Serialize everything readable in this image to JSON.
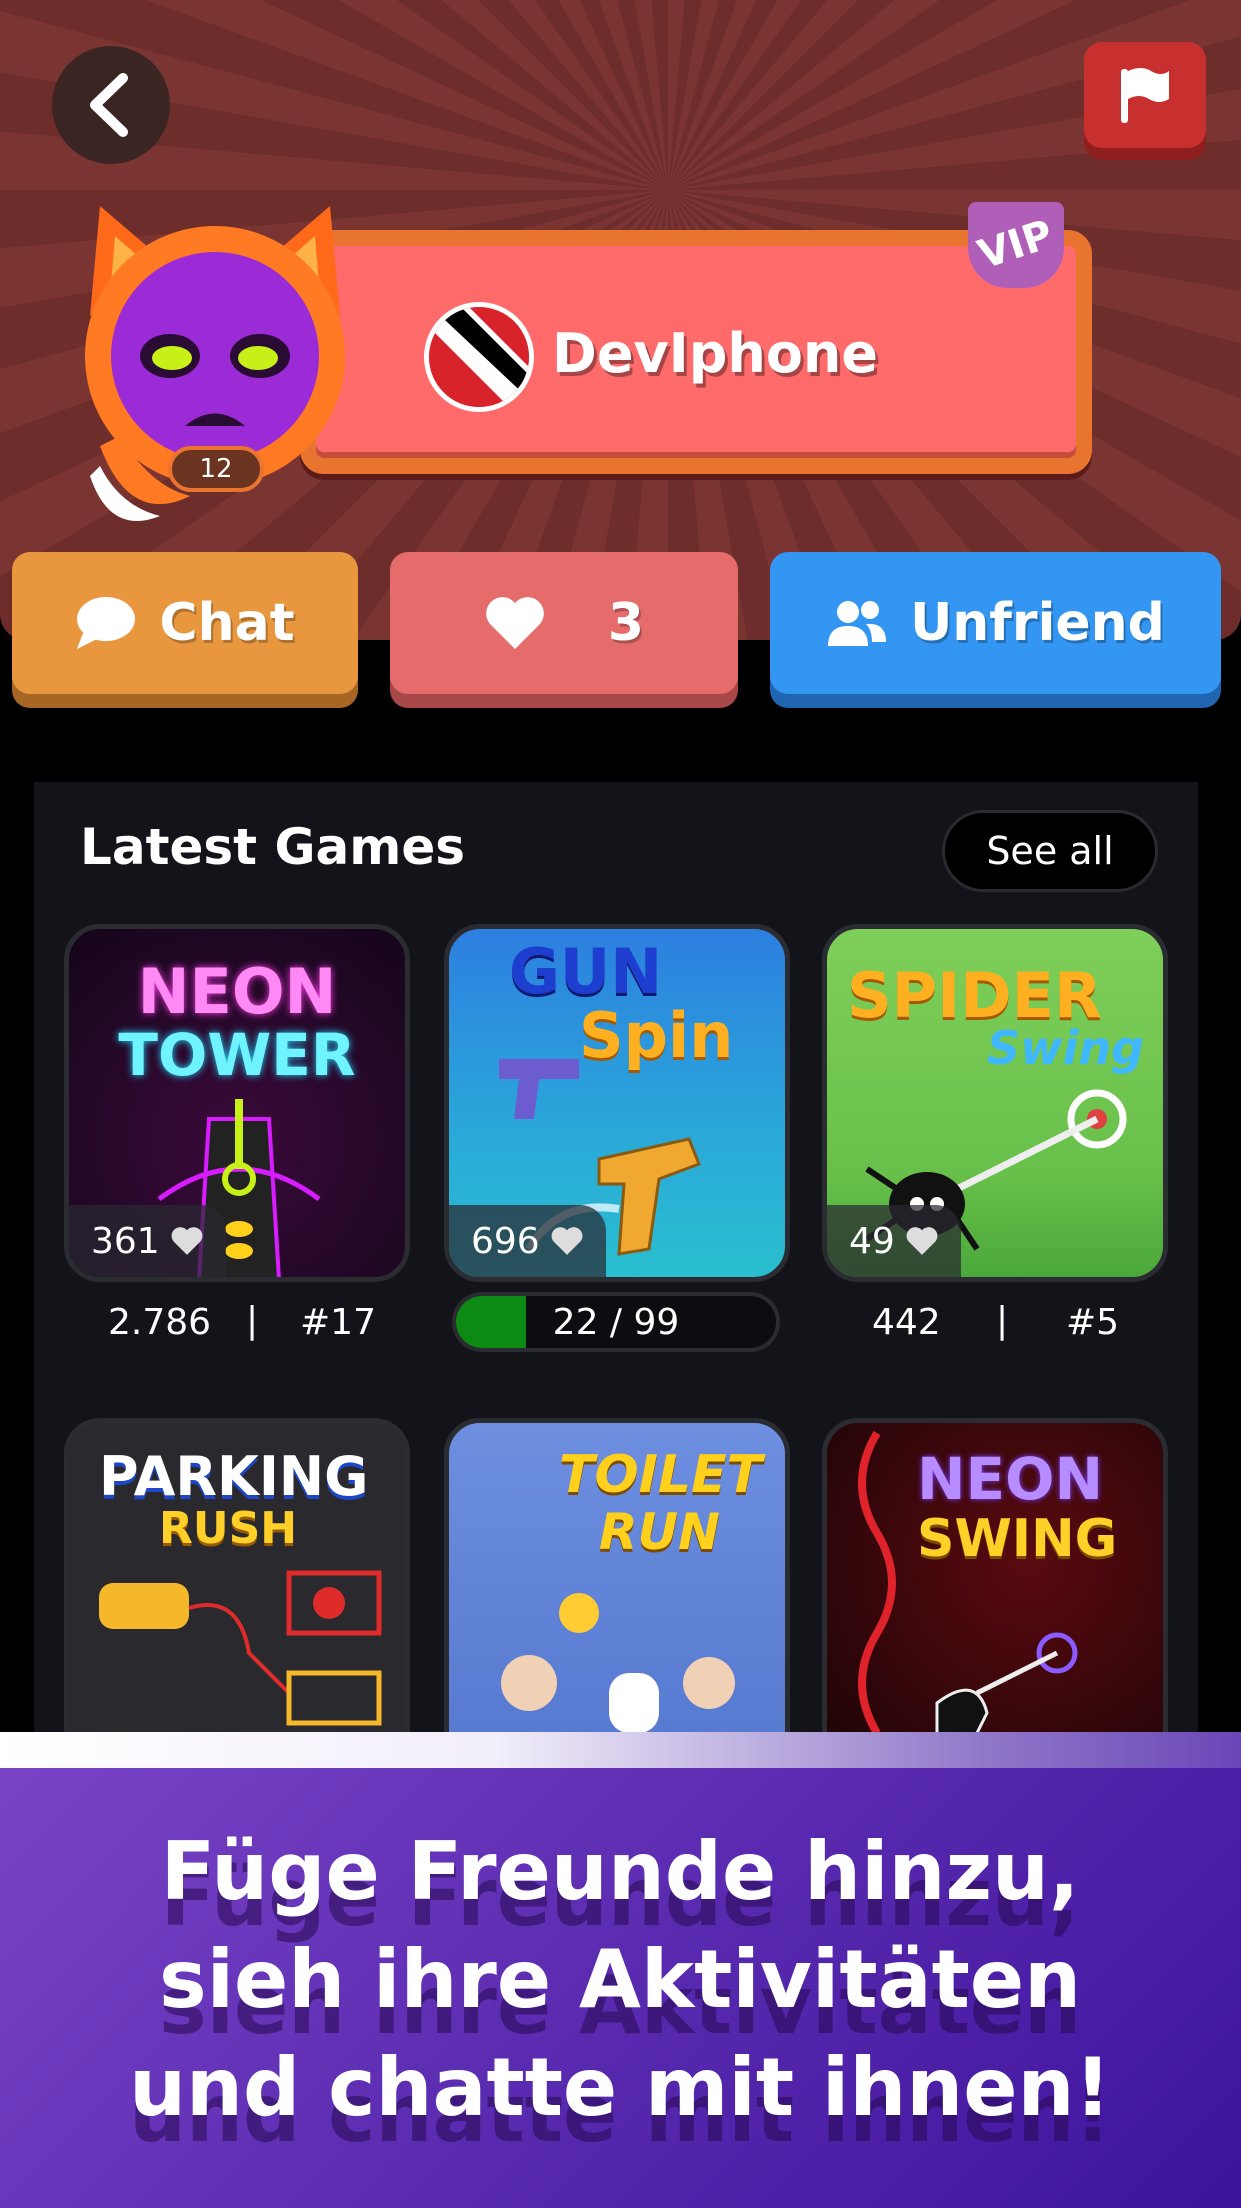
{
  "profile": {
    "username": "DevIphone",
    "level": "12",
    "vip_label": "VIP",
    "likes": "3"
  },
  "actions": {
    "chat_label": "Chat",
    "likes_count": "3",
    "unfriend_label": "Unfriend"
  },
  "latest_games": {
    "title": "Latest Games",
    "see_all": "See all",
    "games": [
      {
        "title_line1": "NEON",
        "title_line2": "TOWER",
        "likes": "361",
        "stat_left": "2.786",
        "stat_right": "#17"
      },
      {
        "title_line1": "GUN",
        "title_line2": "Spin",
        "likes": "696",
        "progress_text": "22 / 99",
        "progress": 0.22
      },
      {
        "title_line1": "SPIDER",
        "title_line2": "Swing",
        "likes": "49",
        "stat_left": "442",
        "stat_right": "#5"
      },
      {
        "title_line1": "PARKING",
        "title_line2": "RUSH"
      },
      {
        "title_line1": "TOILET",
        "title_line2": "RUN"
      },
      {
        "title_line1": "NEON",
        "title_line2": "SWING"
      }
    ]
  },
  "banner": {
    "text": "Füge Freunde hinzu, sieh ihre Aktivitäten und chatte mit ihnen!"
  },
  "colors": {
    "header_red": "#7a3532",
    "chat_orange": "#e9973f",
    "like_red": "#e66c6c",
    "unfriend_blue": "#3296f2",
    "progress_green": "#0d8a14",
    "banner_purple": "#5a2bb0"
  },
  "icons": {
    "back": "chevron-left-icon",
    "report": "flag-icon",
    "chat": "speech-bubble-icon",
    "like": "heart-icon",
    "unfriend": "users-icon"
  }
}
